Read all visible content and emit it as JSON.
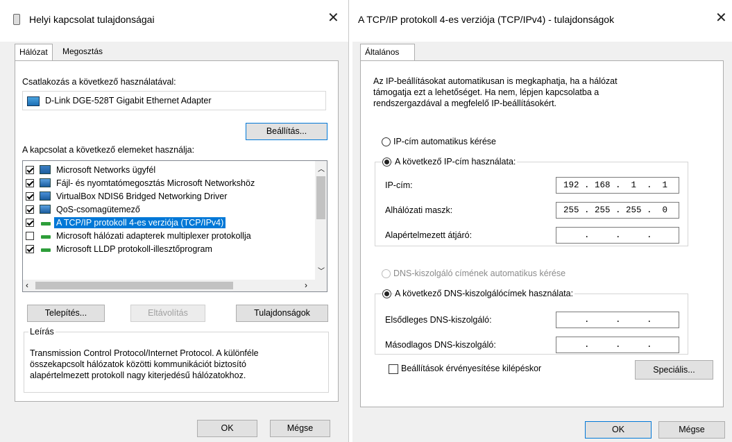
{
  "left_window": {
    "title": "Helyi kapcsolat tulajdonságai",
    "close": "✕",
    "tabs": [
      "Hálózat",
      "Megosztás"
    ],
    "connect_label": "Csatlakozás a következő használatával:",
    "adapter": "D-Link DGE-528T Gigabit Ethernet Adapter",
    "configure_btn": "Beállítás...",
    "items_label": "A kapcsolat a következő elemeket használja:",
    "items": [
      {
        "label": "Microsoft Networks ügyfél",
        "checked": true,
        "icon": "network-client-icon"
      },
      {
        "label": "Fájl- és nyomtatómegosztás Microsoft Networkshöz",
        "checked": true,
        "icon": "file-sharing-icon"
      },
      {
        "label": "VirtualBox NDIS6 Bridged Networking Driver",
        "checked": true,
        "icon": "network-driver-icon"
      },
      {
        "label": "QoS-csomagütemező",
        "checked": true,
        "icon": "qos-icon"
      },
      {
        "label": "A TCP/IP protokoll 4-es verziója (TCP/IPv4)",
        "checked": true,
        "icon": "protocol-icon",
        "selected": true
      },
      {
        "label": "Microsoft hálózati adapterek multiplexer protokollja",
        "checked": false,
        "icon": "protocol-icon"
      },
      {
        "label": "Microsoft LLDP protokoll-illesztőprogram",
        "checked": true,
        "icon": "protocol-icon"
      }
    ],
    "install_btn": "Telepítés...",
    "uninstall_btn": "Eltávolítás",
    "properties_btn": "Tulajdonságok",
    "desc_label": "Leírás",
    "desc_lines": [
      "Transmission Control Protocol/Internet Protocol. A különféle",
      "összekapcsolt hálózatok közötti kommunikációt biztosító",
      "alapértelmezett protokoll nagy kiterjedésű hálózatokhoz."
    ],
    "ok_btn": "OK",
    "cancel_btn": "Mégse"
  },
  "right_window": {
    "title": "A TCP/IP protokoll 4-es verziója (TCP/IPv4) - tulajdonságok",
    "close": "✕",
    "tab": "Általános",
    "intro_lines": [
      "Az IP-beállításokat automatikusan is megkaphatja, ha a hálózat",
      "támogatja ezt a lehetőséget. Ha nem, lépjen kapcsolatba a",
      "rendszergazdával a megfelelő IP-beállításokért."
    ],
    "radio_auto_ip": "IP-cím automatikus kérése",
    "radio_manual_ip": "A következő IP-cím használata:",
    "ip_label": "IP-cím:",
    "ip_value": "192 . 168 .  1  .  1",
    "mask_label": "Alhálózati maszk:",
    "mask_value": "255 . 255 . 255 .  0",
    "gateway_label": "Alapértelmezett átjáró:",
    "gateway_value": "    .     .     .",
    "radio_auto_dns": "DNS-kiszolgáló címének automatikus kérése",
    "radio_manual_dns": "A következő DNS-kiszolgálócímek használata:",
    "dns1_label": "Elsődleges DNS-kiszolgáló:",
    "dns1_value": "    .     .     .",
    "dns2_label": "Másodlagos DNS-kiszolgáló:",
    "dns2_value": "    .     .     .",
    "validate_label": "Beállítások érvényesítése kilépéskor",
    "advanced_btn": "Speciális...",
    "ok_btn": "OK",
    "cancel_btn": "Mégse"
  }
}
